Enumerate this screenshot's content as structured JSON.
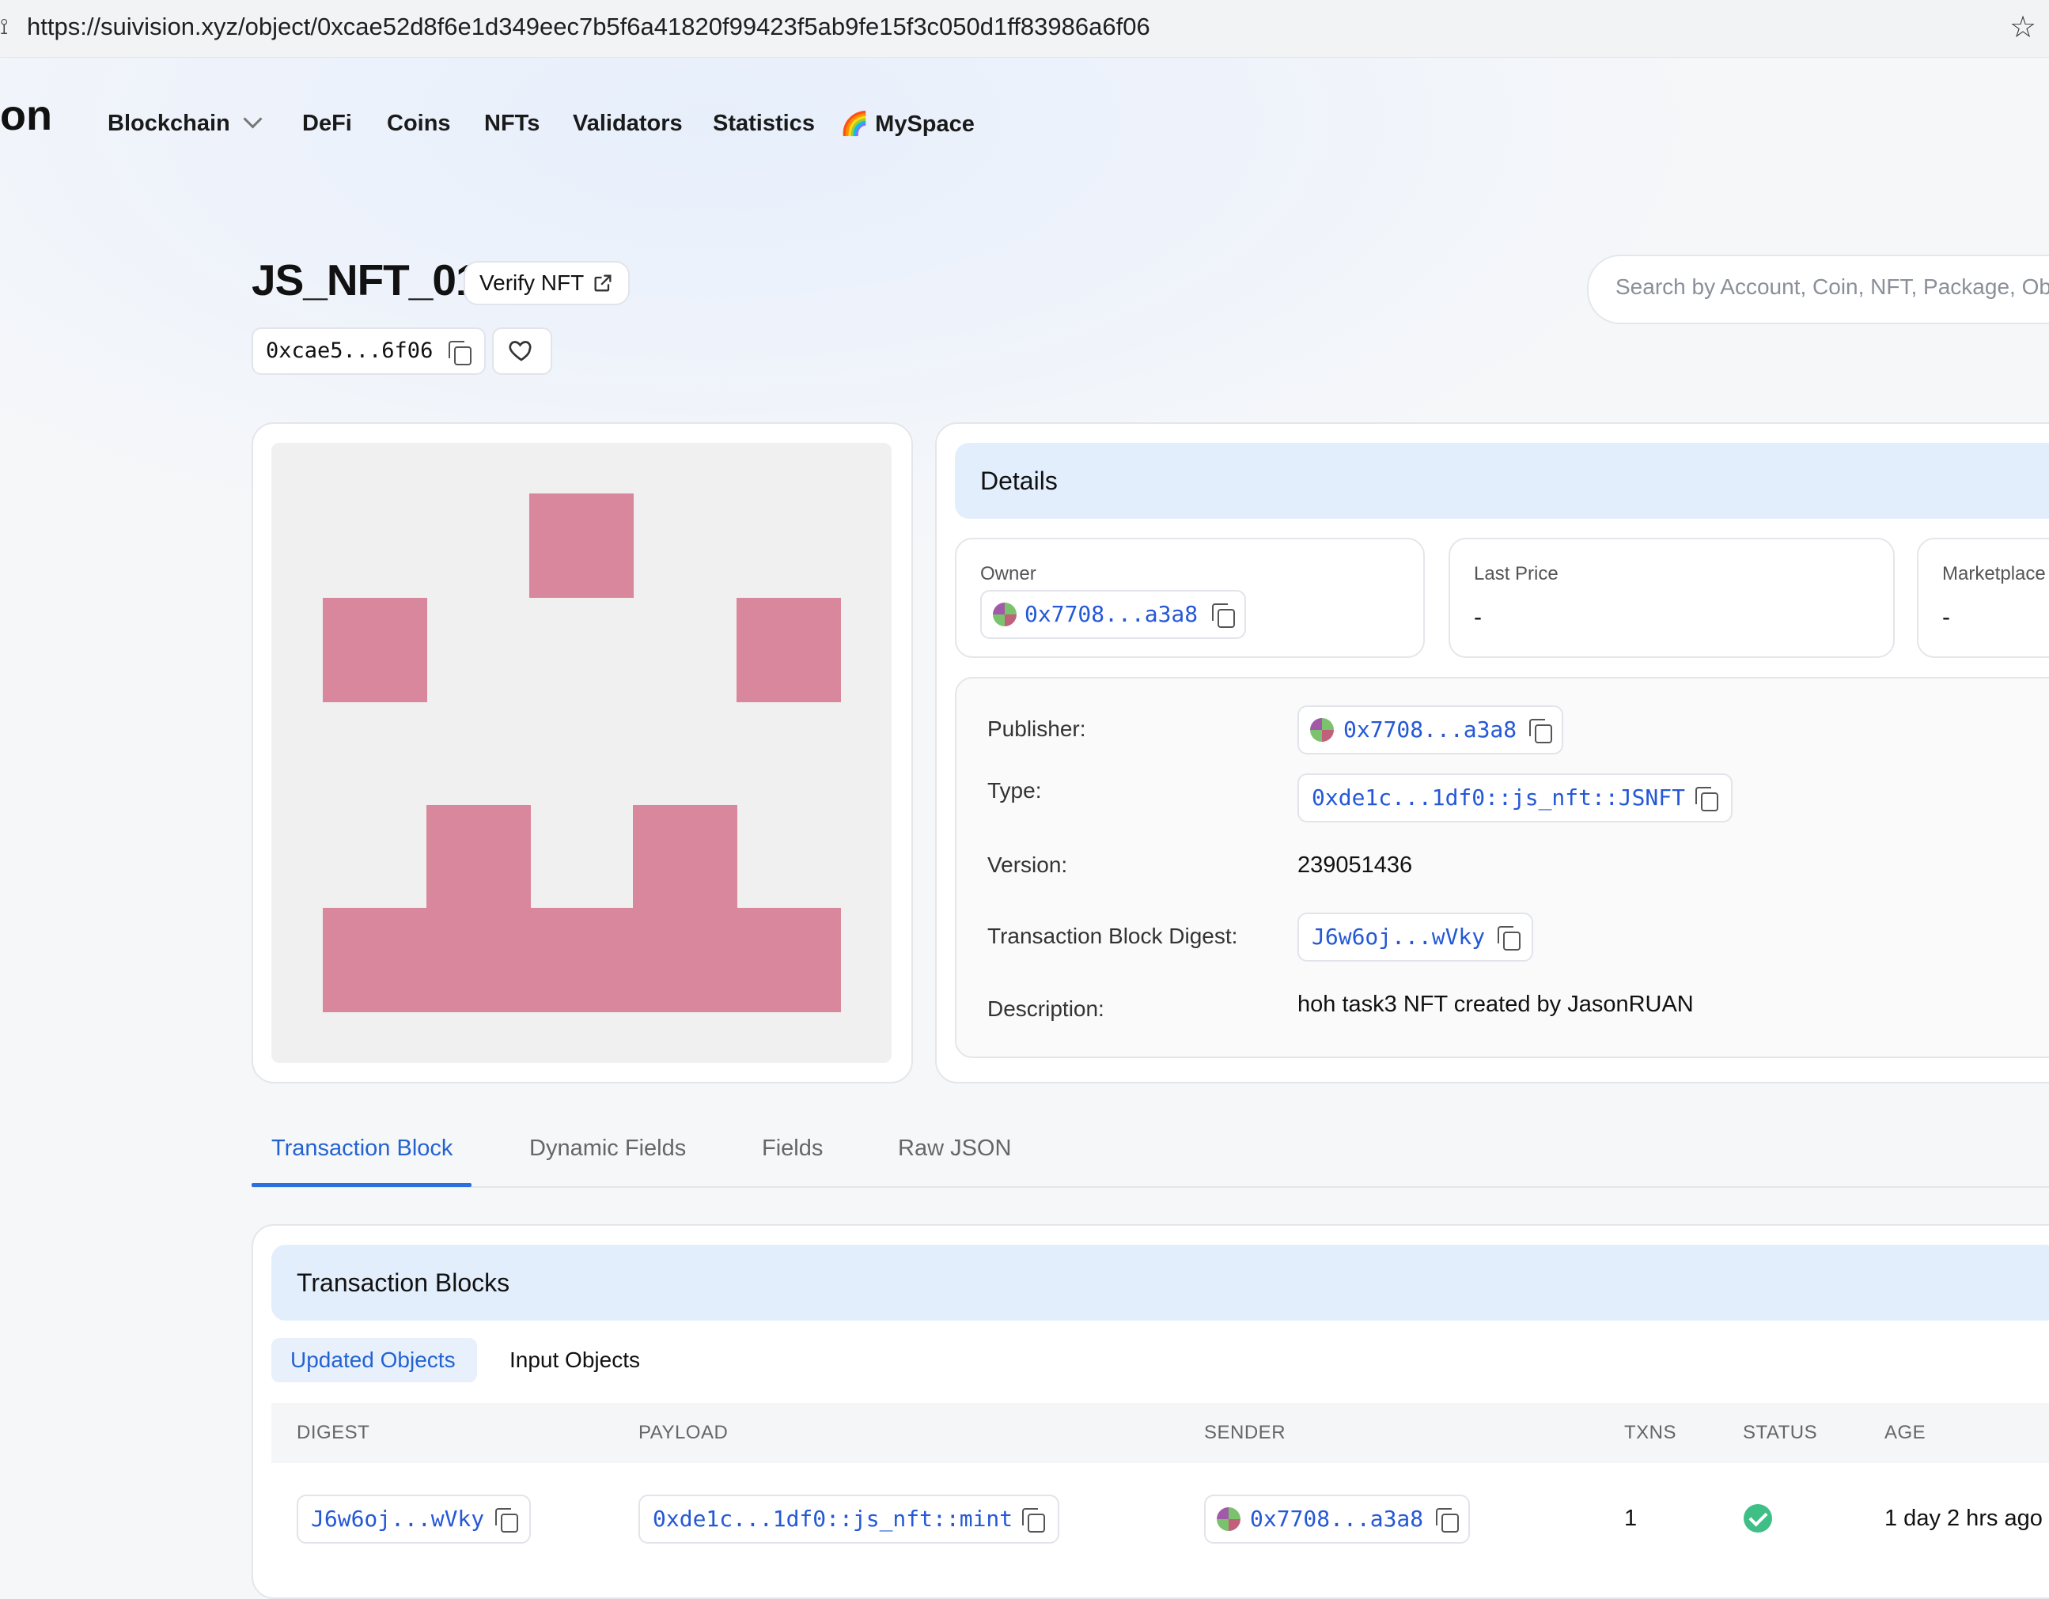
{
  "browser": {
    "url": "https://suivision.xyz/object/0xcae52d8f6e1d349eec7b5f6a41820f99423f5ab9fe15f3c050d1ff83986a6f06"
  },
  "nav": {
    "logo_fragment": "on",
    "items": [
      "Blockchain",
      "DeFi",
      "Coins",
      "NFTs",
      "Validators",
      "Statistics",
      "🌈 MySpace"
    ]
  },
  "object": {
    "title": "JS_NFT_01",
    "verify_label": "Verify NFT",
    "id_short": "0xcae5...6f06"
  },
  "search": {
    "placeholder": "Search by Account, Coin, NFT, Package, Object, Transaction..."
  },
  "nft_image": {
    "background": "#f0f0f0",
    "color": "#d9879c"
  },
  "details": {
    "header": "Details",
    "owner": {
      "label": "Owner",
      "value": "0x7708...a3a8"
    },
    "last_price": {
      "label": "Last Price",
      "value": "-"
    },
    "marketplace": {
      "label": "Marketplace",
      "value": "-"
    },
    "rows": {
      "publisher": {
        "label": "Publisher:",
        "value": "0x7708...a3a8"
      },
      "type": {
        "label": "Type:",
        "value": "0xde1c...1df0::js_nft::JSNFT"
      },
      "version": {
        "label": "Version:",
        "value": "239051436"
      },
      "digest": {
        "label": "Transaction Block Digest:",
        "value": "J6w6oj...wVky"
      },
      "description": {
        "label": "Description:",
        "value": "hoh task3 NFT created by JasonRUAN"
      }
    }
  },
  "tabs": [
    "Transaction Block",
    "Dynamic Fields",
    "Fields",
    "Raw JSON"
  ],
  "transactions": {
    "header": "Transaction Blocks",
    "subtabs": [
      "Updated Objects",
      "Input Objects"
    ],
    "columns": [
      "DIGEST",
      "PAYLOAD",
      "SENDER",
      "TXNS",
      "STATUS",
      "AGE"
    ],
    "rows": [
      {
        "digest": "J6w6oj...wVky",
        "payload": "0xde1c...1df0::js_nft::mint",
        "sender": "0x7708...a3a8",
        "txns": "1",
        "status": "success",
        "age": "1 day 2 hrs ago"
      }
    ]
  },
  "colors": {
    "accent": "#2363d1",
    "card_header": "#e3eefc",
    "status_ok": "#3fbf86"
  }
}
